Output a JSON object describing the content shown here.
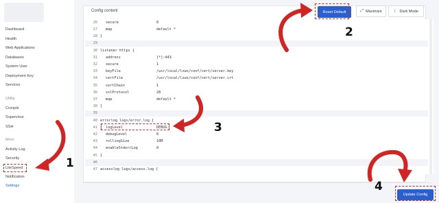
{
  "sidebar": {
    "items": [
      {
        "label": "Dashboard"
      },
      {
        "label": "Health"
      },
      {
        "label": "Web Applications"
      },
      {
        "label": "Databases"
      },
      {
        "label": "System User"
      },
      {
        "label": "Deployment Key"
      },
      {
        "label": "Services"
      }
    ],
    "group_utility": "Utility",
    "utility_items": [
      {
        "label": "Cronjob"
      },
      {
        "label": "Supervisor"
      },
      {
        "label": "SSH"
      }
    ],
    "group_more": "More",
    "more_items": [
      {
        "label": "Activity Log"
      },
      {
        "label": "Security"
      },
      {
        "label": "LiteSpeed"
      },
      {
        "label": "Notification"
      },
      {
        "label": "Settings"
      }
    ]
  },
  "panel": {
    "title": "Config content"
  },
  "toolbar": {
    "reset_label": "Reset Default",
    "maximize_label": "Maximize",
    "darkmode_label": "Dark Mode"
  },
  "editor": {
    "lines": [
      {
        "n": "26",
        "k": "secure",
        "v": "0"
      },
      {
        "n": "27",
        "k": "map",
        "v": "default *"
      },
      {
        "n": "28",
        "text": "}"
      },
      {
        "n": "29",
        "text": ""
      },
      {
        "n": "30",
        "text": "listener https {"
      },
      {
        "n": "31",
        "k": "address",
        "v": "[*]:443"
      },
      {
        "n": "32",
        "k": "secure",
        "v": "1"
      },
      {
        "n": "33",
        "k": "keyFile",
        "v": "/usr/local/lsws/conf/cert/server.key"
      },
      {
        "n": "34",
        "k": "certFile",
        "v": "/usr/local/lsws/conf/cert/server.crt"
      },
      {
        "n": "35",
        "k": "certChain",
        "v": "1"
      },
      {
        "n": "36",
        "k": "sslProtocol",
        "v": "28"
      },
      {
        "n": "37",
        "k": "map",
        "v": "default *"
      },
      {
        "n": "38",
        "text": "}"
      },
      {
        "n": "39",
        "text": ""
      },
      {
        "n": "40",
        "text": "errorlog logs/error.log {"
      },
      {
        "n": "41",
        "k": "logLevel",
        "v": "DEBUG"
      },
      {
        "n": "42",
        "k": "debugLevel",
        "v": "0"
      },
      {
        "n": "43",
        "k": "rollingSize",
        "v": "10M"
      },
      {
        "n": "44",
        "k": "enableStderrLog",
        "v": "0"
      },
      {
        "n": "45",
        "text": "}"
      },
      {
        "n": "46",
        "text": ""
      },
      {
        "n": "47",
        "text": "accesslog logs/access.log {"
      }
    ]
  },
  "footer": {
    "update_label": "Update Config"
  },
  "annotations": {
    "step1": "1",
    "step2": "2",
    "step3": "3",
    "step4": "4"
  },
  "colors": {
    "accent": "#2b5fce",
    "annotation": "#d32424"
  }
}
